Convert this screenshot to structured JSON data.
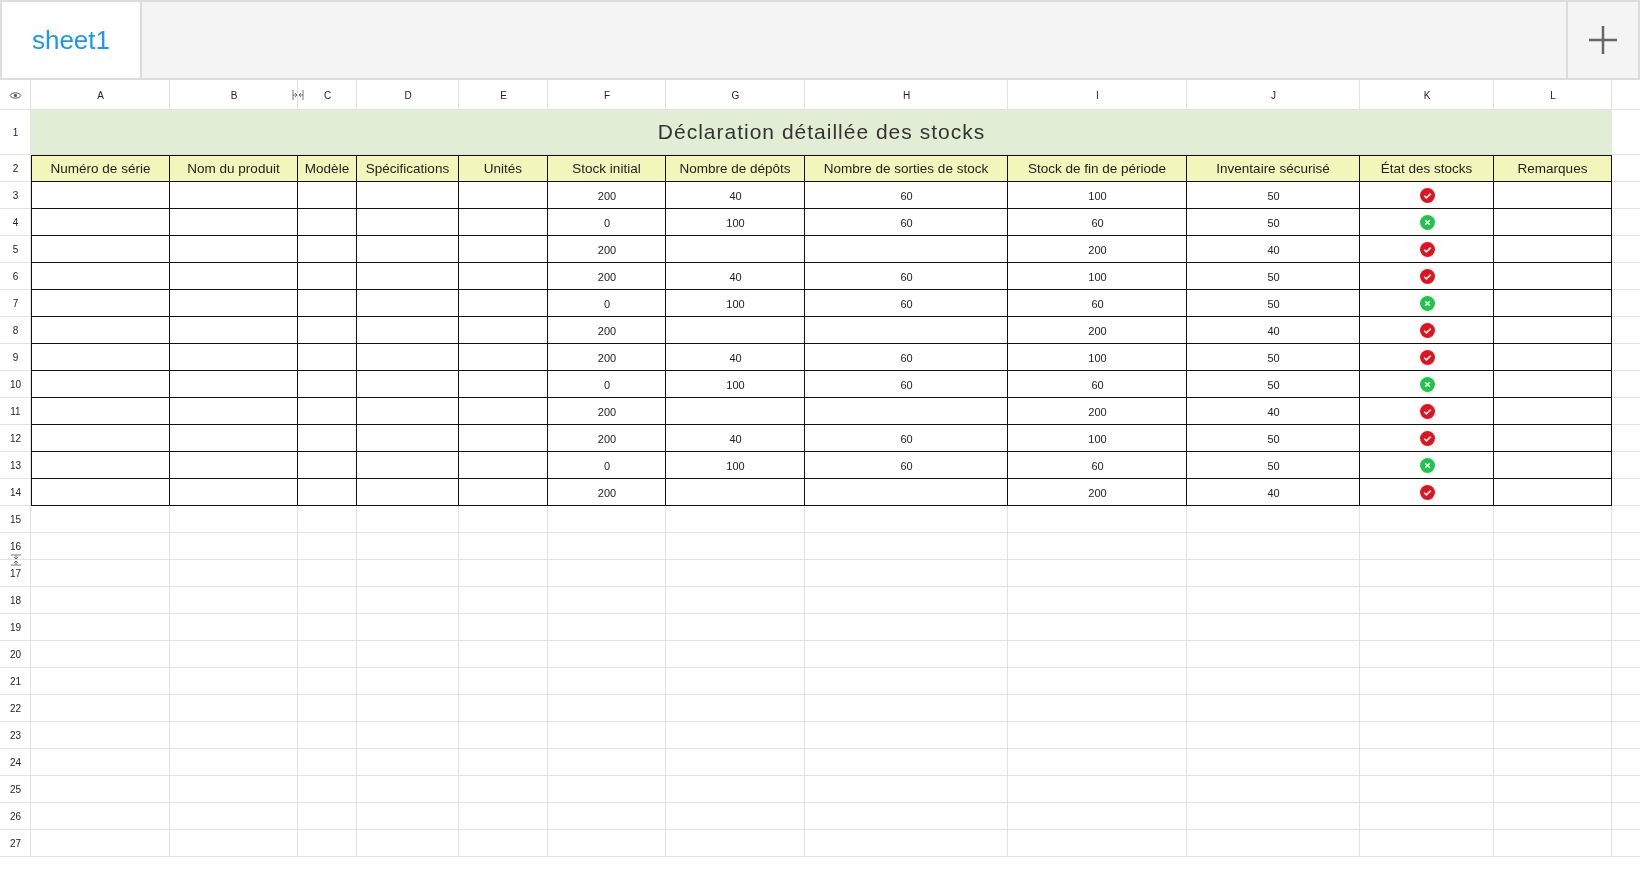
{
  "tabs": [
    {
      "label": "sheet1",
      "selected": true
    }
  ],
  "column_headers": [
    "A",
    "B",
    "C",
    "D",
    "E",
    "F",
    "G",
    "H",
    "I",
    "J",
    "K",
    "L"
  ],
  "row_numbers": [
    "1",
    "2",
    "3",
    "4",
    "5",
    "6",
    "7",
    "8",
    "9",
    "10",
    "11",
    "12",
    "13",
    "14",
    "15",
    "16",
    "17",
    "18",
    "19",
    "20",
    "21",
    "22",
    "23",
    "24",
    "25",
    "26",
    "27"
  ],
  "title": "Déclaration détaillée des stocks",
  "table": {
    "columns": [
      "Numéro de série",
      "Nom du produit",
      "Modèle",
      "Spécifications",
      "Unités",
      "Stock initial",
      "Nombre de dépôts",
      "Nombre de sorties de stock",
      "Stock de fin de période",
      "Inventaire sécurisé",
      "État des stocks",
      "Remarques"
    ],
    "rows": [
      {
        "stock_initial": "200",
        "depots": "40",
        "sorties": "60",
        "fin": "100",
        "securise": "50",
        "kind": "check"
      },
      {
        "stock_initial": "0",
        "depots": "100",
        "sorties": "60",
        "fin": "60",
        "securise": "50",
        "kind": "cross"
      },
      {
        "stock_initial": "200",
        "fin": "200",
        "securise": "40",
        "kind": "check"
      },
      {
        "stock_initial": "200",
        "depots": "40",
        "sorties": "60",
        "fin": "100",
        "securise": "50",
        "kind": "check"
      },
      {
        "stock_initial": "0",
        "depots": "100",
        "sorties": "60",
        "fin": "60",
        "securise": "50",
        "kind": "cross"
      },
      {
        "stock_initial": "200",
        "fin": "200",
        "securise": "40",
        "kind": "check"
      },
      {
        "stock_initial": "200",
        "depots": "40",
        "sorties": "60",
        "fin": "100",
        "securise": "50",
        "kind": "check"
      },
      {
        "stock_initial": "0",
        "depots": "100",
        "sorties": "60",
        "fin": "60",
        "securise": "50",
        "kind": "cross"
      },
      {
        "stock_initial": "200",
        "fin": "200",
        "securise": "40",
        "kind": "check"
      },
      {
        "stock_initial": "200",
        "depots": "40",
        "sorties": "60",
        "fin": "100",
        "securise": "50",
        "kind": "check"
      },
      {
        "stock_initial": "0",
        "depots": "100",
        "sorties": "60",
        "fin": "60",
        "securise": "50",
        "kind": "cross"
      },
      {
        "stock_initial": "200",
        "fin": "200",
        "securise": "40",
        "kind": "check"
      }
    ]
  }
}
